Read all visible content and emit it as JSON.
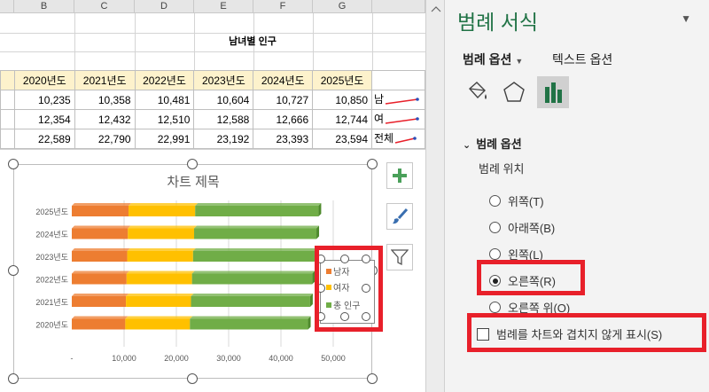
{
  "columns": [
    "B",
    "C",
    "D",
    "E",
    "F",
    "G"
  ],
  "sheet_title": "남녀별 인구",
  "table": {
    "years": [
      "2020년도",
      "2021년도",
      "2022년도",
      "2023년도",
      "2024년도",
      "2025년도"
    ],
    "rows": [
      {
        "values": [
          "10,235",
          "10,358",
          "10,481",
          "10,604",
          "10,727",
          "10,850"
        ],
        "label": "남"
      },
      {
        "values": [
          "12,354",
          "12,432",
          "12,510",
          "12,588",
          "12,666",
          "12,744"
        ],
        "label": "여"
      },
      {
        "values": [
          "22,589",
          "22,790",
          "22,991",
          "23,192",
          "23,393",
          "23,594"
        ],
        "label": "전체"
      }
    ]
  },
  "chart_data": {
    "type": "bar",
    "orientation": "horizontal",
    "stacked": true,
    "title": "차트 제목",
    "categories": [
      "2020년도",
      "2021년도",
      "2022년도",
      "2023년도",
      "2024년도",
      "2025년도"
    ],
    "series": [
      {
        "name": "남자",
        "color": "#ed7d31",
        "values": [
          10235,
          10358,
          10481,
          10604,
          10727,
          10850
        ]
      },
      {
        "name": "여자",
        "color": "#ffc000",
        "values": [
          12354,
          12432,
          12510,
          12588,
          12666,
          12744
        ]
      },
      {
        "name": "총 인구",
        "color": "#70ad47",
        "values": [
          22589,
          22790,
          22991,
          23192,
          23393,
          23594
        ]
      }
    ],
    "xlim": [
      0,
      50000
    ],
    "xticks": [
      "-",
      "10,000",
      "20,000",
      "30,000",
      "40,000",
      "50,000"
    ],
    "legend_position": "right",
    "grid": true
  },
  "chart_side_buttons": {
    "add": "plus-icon",
    "style": "brush-icon",
    "filter": "filter-icon"
  },
  "pane": {
    "title": "범례 서식",
    "tabs": {
      "legend_options": "범례 옵션",
      "text_options": "텍스트 옵션"
    },
    "icons": [
      "fill-bucket-icon",
      "pentagon-icon",
      "bar-chart-icon"
    ],
    "section": "범례 옵션",
    "position_label": "범례 위치",
    "options": [
      "위쪽(T)",
      "아래쪽(B)",
      "왼쪽(L)",
      "오른쪽(R)",
      "오른쪽 위(O)"
    ],
    "selected": "오른쪽(R)",
    "overlap_checkbox": "범례를 차트와 겹치지 않게 표시(S)"
  },
  "highlight_color": "#e8202a",
  "accent_color": "#217346"
}
